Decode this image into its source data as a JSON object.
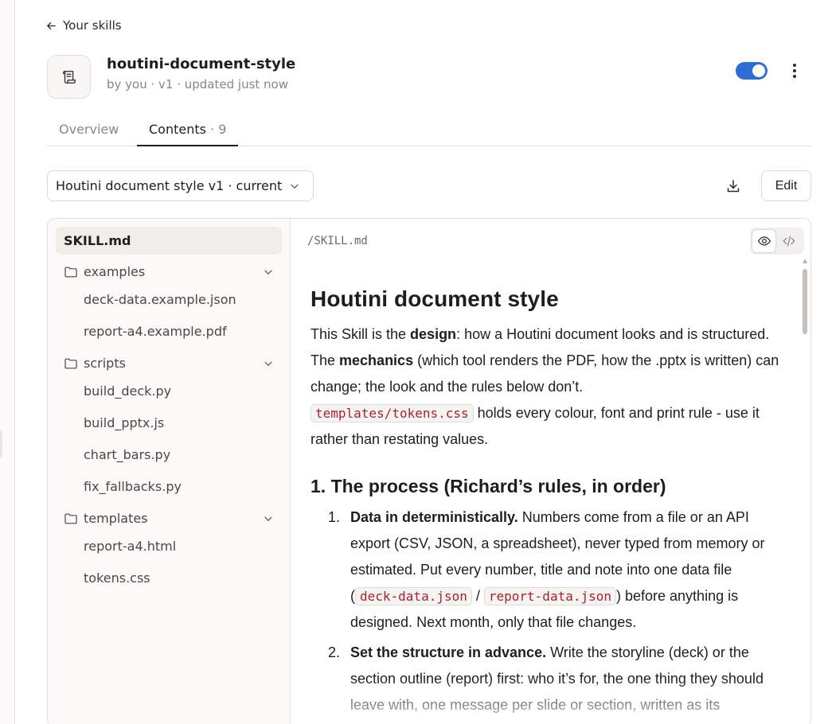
{
  "nav": {
    "back_label": "Your skills"
  },
  "skill": {
    "title": "houtini-document-style",
    "meta": "by you · v1 · updated just now",
    "enabled": true
  },
  "tabs": {
    "overview": "Overview",
    "contents": "Contents",
    "contents_count": "· 9"
  },
  "toolbar": {
    "version": "Houtini document style v1 · current",
    "edit_label": "Edit"
  },
  "tree": {
    "selected": "SKILL.md",
    "folders": [
      {
        "name": "examples",
        "files": [
          "deck-data.example.json",
          "report-a4.example.pdf"
        ]
      },
      {
        "name": "scripts",
        "files": [
          "build_deck.py",
          "build_pptx.js",
          "chart_bars.py",
          "fix_fallbacks.py"
        ]
      },
      {
        "name": "templates",
        "files": [
          "report-a4.html",
          "tokens.css"
        ]
      }
    ]
  },
  "viewer": {
    "path": "/SKILL.md",
    "mode": "preview"
  },
  "doc": {
    "h1": "Houtini document style",
    "intro": {
      "t1": "This Skill is the ",
      "b1": "design",
      "t2": ": how a Houtini document looks and is structured. The ",
      "b2": "mechanics",
      "t3": " (which tool renders the PDF, how the .pptx is written) can change; the look and the rules below don’t.",
      "code": "templates/tokens.css",
      "t4": " holds every colour, font and print rule - use it rather than restating values."
    },
    "h2": "1. The process (Richard’s rules, in order)",
    "items": [
      {
        "num": "1.",
        "bold": "Data in deterministically.",
        "text": " Numbers come from a file or an API export (CSV, JSON, a spreadsheet), never typed from memory or estimated. Put every number, title and note into one data file (",
        "code1": "deck-data.json",
        "sep": " / ",
        "code2": "report-data.json",
        "text2": ") before anything is designed. Next month, only that file changes."
      },
      {
        "num": "2.",
        "bold": "Set the structure in advance.",
        "text": " Write the storyline (deck) or the section outline (report) first: who it’s for, the one thing they should leave with, one message per slide or section, written as its"
      }
    ]
  }
}
